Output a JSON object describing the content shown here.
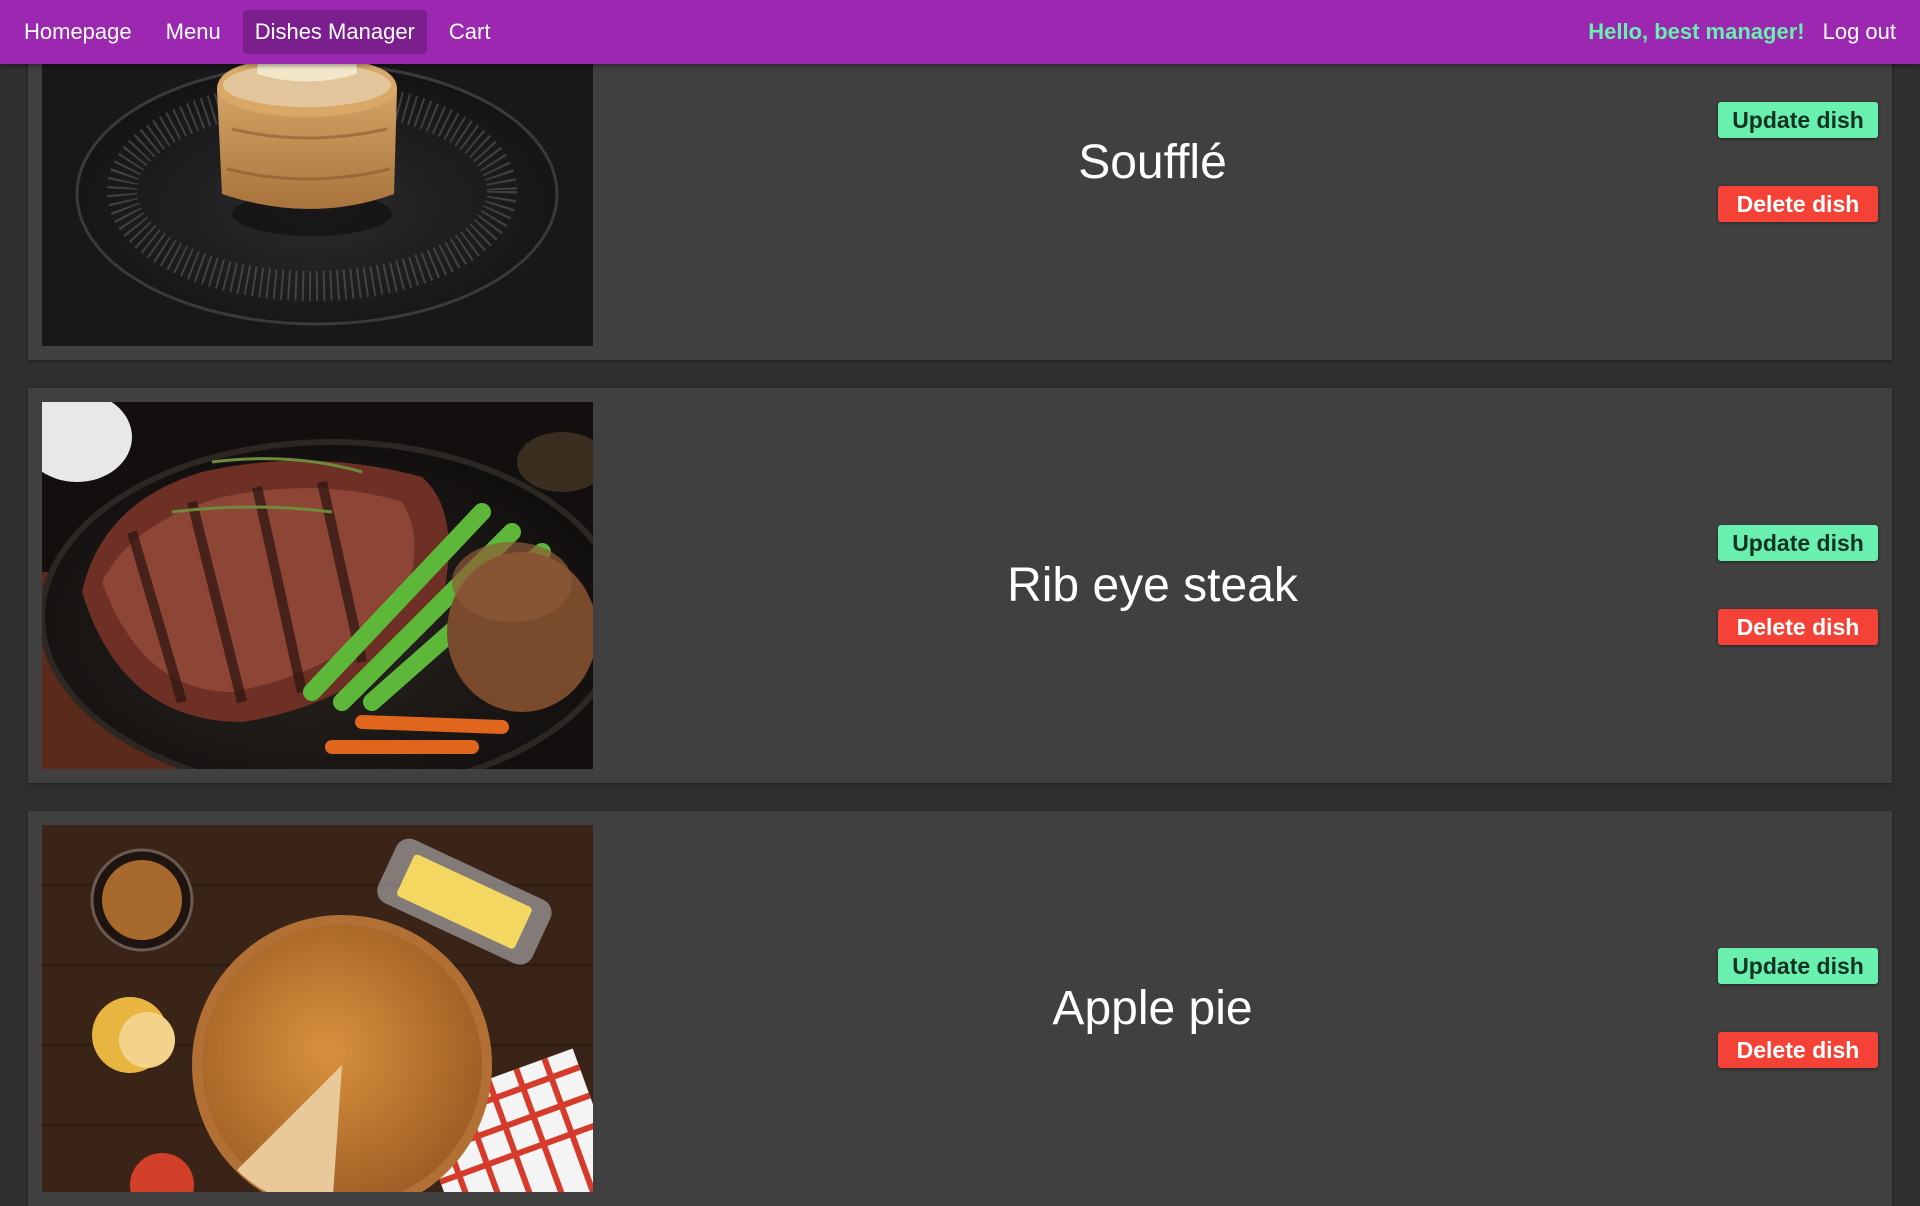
{
  "nav": {
    "links": [
      {
        "label": "Homepage"
      },
      {
        "label": "Menu"
      },
      {
        "label": "Dishes Manager"
      },
      {
        "label": "Cart"
      }
    ],
    "greeting": "Hello, best manager!",
    "logout": "Log out"
  },
  "dishes": [
    {
      "name": "Soufflé",
      "update_label": "Update dish",
      "delete_label": "Delete dish"
    },
    {
      "name": "Rib eye steak",
      "update_label": "Update dish",
      "delete_label": "Delete dish"
    },
    {
      "name": "Apple pie",
      "update_label": "Update dish",
      "delete_label": "Delete dish"
    }
  ],
  "colors": {
    "navbar": "#9c27b0",
    "nav_active": "#7b1f8f",
    "greeting": "#69f0ae",
    "card": "#404040",
    "page_bg": "#2f2f2f",
    "update_button": "#69f0ae",
    "delete_button": "#f44336"
  }
}
